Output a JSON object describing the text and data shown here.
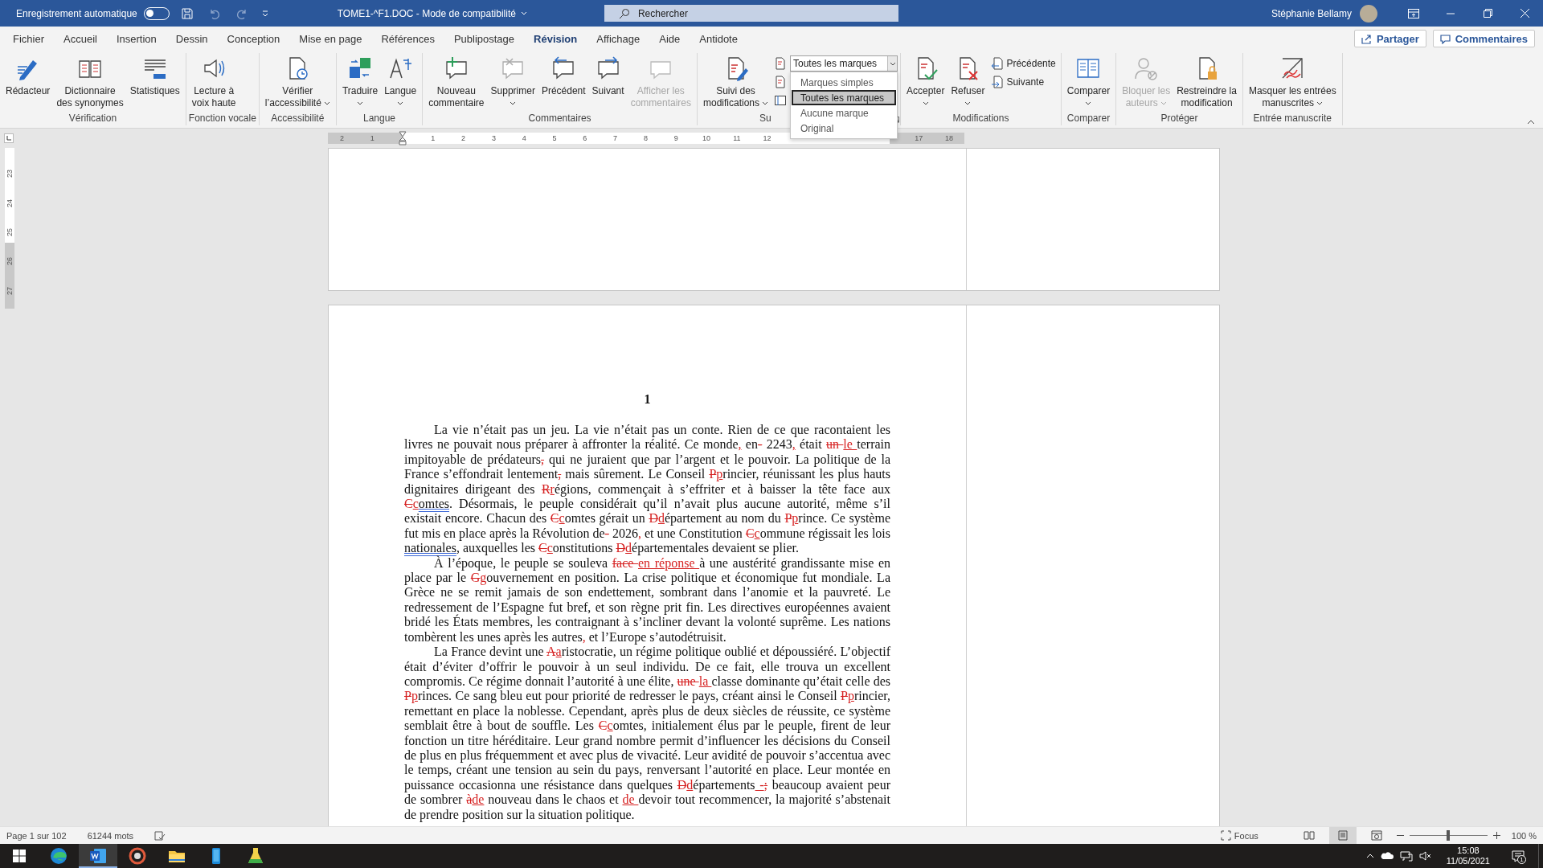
{
  "title_bar": {
    "autosave_label": "Enregistrement automatique",
    "autosave_on": false,
    "document_title": "TOME1-^F1.DOC  -  Mode de compatibilité",
    "search_placeholder": "Rechercher",
    "user_name": "Stéphanie Bellamy"
  },
  "menu_tabs": [
    {
      "label": "Fichier",
      "selected": false
    },
    {
      "label": "Accueil",
      "selected": false
    },
    {
      "label": "Insertion",
      "selected": false
    },
    {
      "label": "Dessin",
      "selected": false
    },
    {
      "label": "Conception",
      "selected": false
    },
    {
      "label": "Mise en page",
      "selected": false
    },
    {
      "label": "Références",
      "selected": false
    },
    {
      "label": "Publipostage",
      "selected": false
    },
    {
      "label": "Révision",
      "selected": true
    },
    {
      "label": "Affichage",
      "selected": false
    },
    {
      "label": "Aide",
      "selected": false
    },
    {
      "label": "Antidote",
      "selected": false
    }
  ],
  "share_button": "Partager",
  "comments_button": "Commentaires",
  "ribbon_groups": [
    {
      "label": "Vérification",
      "launcher": false,
      "commands": [
        {
          "label_lines": [
            "Rédacteur"
          ],
          "disabled": false,
          "dropdown": false
        },
        {
          "label_lines": [
            "Dictionnaire",
            "des synonymes"
          ],
          "disabled": false,
          "dropdown": false
        },
        {
          "label_lines": [
            "Statistiques"
          ],
          "disabled": false,
          "dropdown": false
        }
      ]
    },
    {
      "label": "Fonction vocale",
      "launcher": false,
      "commands": [
        {
          "label_lines": [
            "Lecture à",
            "voix haute"
          ],
          "disabled": false,
          "dropdown": false
        }
      ]
    },
    {
      "label": "Accessibilité",
      "launcher": false,
      "commands": [
        {
          "label_lines": [
            "Vérifier",
            "l’accessibilité"
          ],
          "disabled": false,
          "dropdown": true
        }
      ]
    },
    {
      "label": "Langue",
      "launcher": false,
      "commands": [
        {
          "label_lines": [
            "Traduire"
          ],
          "disabled": false,
          "dropdown": true
        },
        {
          "label_lines": [
            "Langue"
          ],
          "disabled": false,
          "dropdown": true
        }
      ]
    },
    {
      "label": "Commentaires",
      "launcher": false,
      "commands": [
        {
          "label_lines": [
            "Nouveau",
            "commentaire"
          ],
          "disabled": false,
          "dropdown": false
        },
        {
          "label_lines": [
            "Supprimer"
          ],
          "disabled": false,
          "dropdown": true
        },
        {
          "label_lines": [
            "Précédent"
          ],
          "disabled": false,
          "dropdown": false
        },
        {
          "label_lines": [
            "Suivant"
          ],
          "disabled": false,
          "dropdown": false
        },
        {
          "label_lines": [
            "Afficher les",
            "commentaires"
          ],
          "disabled": true,
          "dropdown": false
        }
      ]
    },
    {
      "label": "Su",
      "launcher": true,
      "commands": [
        {
          "label_lines": [
            "Suivi des",
            "modifications"
          ],
          "disabled": false,
          "dropdown": true
        }
      ],
      "small_items": [
        {
          "kind": "select",
          "value": "Toutes les marques",
          "options": [
            {
              "label": "Marques simples",
              "selected": false
            },
            {
              "label": "Toutes les marques",
              "selected": true
            },
            {
              "label": "Aucune marque",
              "selected": false
            },
            {
              "label": "Original",
              "selected": false
            }
          ]
        },
        {
          "kind": "icon"
        },
        {
          "kind": "icon"
        }
      ]
    },
    {
      "label": "Modifications",
      "launcher": false,
      "commands": [
        {
          "label_lines": [
            "Accepter"
          ],
          "disabled": false,
          "dropdown": true
        },
        {
          "label_lines": [
            "Refuser"
          ],
          "disabled": false,
          "dropdown": true
        }
      ],
      "small_items": [
        {
          "kind": "button",
          "label": "Précédente"
        },
        {
          "kind": "button",
          "label": "Suivante"
        }
      ]
    },
    {
      "label": "Comparer",
      "launcher": false,
      "commands": [
        {
          "label_lines": [
            "Comparer"
          ],
          "disabled": false,
          "dropdown": true
        }
      ]
    },
    {
      "label": "Protéger",
      "launcher": false,
      "commands": [
        {
          "label_lines": [
            "Bloquer les",
            "auteurs"
          ],
          "disabled": true,
          "dropdown": true
        },
        {
          "label_lines": [
            "Restreindre la",
            "modification"
          ],
          "disabled": false,
          "dropdown": false
        }
      ]
    },
    {
      "label": "Entrée manuscrite",
      "launcher": false,
      "commands": [
        {
          "label_lines": [
            "Masquer les entrées",
            "manuscrites"
          ],
          "disabled": false,
          "dropdown": true
        }
      ]
    }
  ],
  "ruler": {
    "before_indent": [
      "2",
      "1"
    ],
    "after_indent": [
      "1",
      "2",
      "3",
      "4",
      "5",
      "6",
      "7",
      "8",
      "9",
      "10",
      "11",
      "12"
    ],
    "end": [
      "17",
      "18"
    ]
  },
  "vertical_ruler": [
    "23",
    "24",
    "25",
    "26",
    "27"
  ],
  "document": {
    "heading": "1",
    "paragraphs": [
      {
        "runs": [
          {
            "kind": "text",
            "text": "La vie n’était pas un jeu. La vie n’était pas un conte. Rien de ce que racontaient les livres ne pouvait nous préparer à affronter la réalité. Ce monde"
          },
          {
            "kind": "inserted",
            "text": ","
          },
          {
            "kind": "text",
            "text": " en"
          },
          {
            "kind": "deleted",
            "text": "-"
          },
          {
            "kind": "text",
            "text": " 2243"
          },
          {
            "kind": "inserted",
            "text": ","
          },
          {
            "kind": "text",
            "text": " était "
          },
          {
            "kind": "deleted",
            "text": "un "
          },
          {
            "kind": "inserted",
            "text": "le "
          },
          {
            "kind": "text",
            "text": "terrain impitoyable de prédateurs"
          },
          {
            "kind": "deleted",
            "text": ","
          },
          {
            "kind": "text",
            "text": " qui ne juraient que par l’argent et le pouvoir. La politique de la France s’effondrait lentement"
          },
          {
            "kind": "deleted",
            "text": ","
          },
          {
            "kind": "text",
            "text": " mais sûrement. Le Conseil "
          },
          {
            "kind": "deleted",
            "text": "P"
          },
          {
            "kind": "inserted",
            "text": "p"
          },
          {
            "kind": "text",
            "text": "rincier, réunissant les plus hauts dignitaires dirigeant des "
          },
          {
            "kind": "deleted",
            "text": "R"
          },
          {
            "kind": "inserted",
            "text": "r"
          },
          {
            "kind": "text",
            "text": "égions, commençait à s’effriter et à baisser la tête face aux "
          },
          {
            "kind": "deleted",
            "text": "C"
          },
          {
            "kind": "inserted",
            "text": "c"
          },
          {
            "kind": "flagged",
            "text": "omtes"
          },
          {
            "kind": "text",
            "text": ". Désormais, le peuple considérait qu’il n’avait plus aucune autorité, même s’il existait encore. Chacun des "
          },
          {
            "kind": "deleted",
            "text": "C"
          },
          {
            "kind": "inserted",
            "text": "c"
          },
          {
            "kind": "text",
            "text": "omtes gérait un "
          },
          {
            "kind": "deleted",
            "text": "D"
          },
          {
            "kind": "inserted",
            "text": "d"
          },
          {
            "kind": "text",
            "text": "épartement au nom du "
          },
          {
            "kind": "deleted",
            "text": "P"
          },
          {
            "kind": "inserted",
            "text": "p"
          },
          {
            "kind": "text",
            "text": "rince. Ce système fut mis en place après la Révolution de"
          },
          {
            "kind": "deleted",
            "text": "-"
          },
          {
            "kind": "text",
            "text": " 2026"
          },
          {
            "kind": "inserted",
            "text": ","
          },
          {
            "kind": "text",
            "text": " et une Constitution "
          },
          {
            "kind": "deleted",
            "text": "C"
          },
          {
            "kind": "inserted",
            "text": "c"
          },
          {
            "kind": "text",
            "text": "ommune régissait les lois "
          },
          {
            "kind": "flagged",
            "text": "nationales"
          },
          {
            "kind": "text",
            "text": ", auxquelles les "
          },
          {
            "kind": "deleted",
            "text": "C"
          },
          {
            "kind": "inserted",
            "text": "c"
          },
          {
            "kind": "text",
            "text": "onstitutions "
          },
          {
            "kind": "deleted",
            "text": "D"
          },
          {
            "kind": "inserted",
            "text": "d"
          },
          {
            "kind": "text",
            "text": "épartementales devaient se plier."
          }
        ]
      },
      {
        "runs": [
          {
            "kind": "text",
            "text": "À l’époque, le peuple se souleva "
          },
          {
            "kind": "deleted",
            "text": "face "
          },
          {
            "kind": "inserted",
            "text": "en réponse "
          },
          {
            "kind": "text",
            "text": "à une austérité grandissante mise en place par le "
          },
          {
            "kind": "deleted",
            "text": "G"
          },
          {
            "kind": "inserted",
            "text": "g"
          },
          {
            "kind": "text",
            "text": "ouvernement en position. La crise politique et économique fut mondiale. La Grèce ne se remit jamais de son endettement, sombrant dans l’anomie et la pauvreté. Le redressement de l’Espagne fut bref, et son règne prit fin. Les directives européennes avaient bridé les États membres, les contraignant à s’incliner devant la volonté suprême. Les nations tombèrent les unes après les autres"
          },
          {
            "kind": "inserted",
            "text": ","
          },
          {
            "kind": "text",
            "text": " et l’Europe s’autodétruisit."
          }
        ]
      },
      {
        "runs": [
          {
            "kind": "text",
            "text": "La France devint une "
          },
          {
            "kind": "deleted",
            "text": "A"
          },
          {
            "kind": "inserted",
            "text": "a"
          },
          {
            "kind": "text",
            "text": "ristocratie, un régime politique oublié et dépoussiéré. L’objectif était d’éviter d’offrir le pouvoir à un seul individu. De ce fait, elle trouva un excellent compromis. Ce régime donnait l’autorité à une élite, "
          },
          {
            "kind": "deleted",
            "text": "une "
          },
          {
            "kind": "inserted",
            "text": "la "
          },
          {
            "kind": "text",
            "text": "classe dominante qu’était celle des "
          },
          {
            "kind": "deleted",
            "text": "P"
          },
          {
            "kind": "inserted",
            "text": "p"
          },
          {
            "kind": "text",
            "text": "rinces. Ce sang bleu eut pour priorité de redresser le pays, créant ainsi le Conseil "
          },
          {
            "kind": "deleted",
            "text": "P"
          },
          {
            "kind": "inserted",
            "text": "p"
          },
          {
            "kind": "text",
            "text": "rincier, remettant en place la noblesse. Cependant, après plus de deux siècles de réussite, ce système semblait être à bout de souffle. Les "
          },
          {
            "kind": "deleted",
            "text": "C"
          },
          {
            "kind": "inserted",
            "text": "c"
          },
          {
            "kind": "text",
            "text": "omtes, initialement élus par le peuple, firent de leur fonction un titre héréditaire. Leur grand nombre permit d’influencer les décisions du Conseil de plus en plus fréquemment et avec plus de vivacité. Leur avidité de pouvoir s’accentua avec le temps, créant une tension au sein du pays, renversant l’autorité en place. Leur montée en puissance occasionna une résistance dans quelques "
          },
          {
            "kind": "deleted",
            "text": "D"
          },
          {
            "kind": "inserted",
            "text": "d"
          },
          {
            "kind": "text",
            "text": "épartements"
          },
          {
            "kind": "inserted",
            "text": " -"
          },
          {
            "kind": "deleted",
            "text": ";"
          },
          {
            "kind": "text",
            "text": " beaucoup avaient peur de sombrer "
          },
          {
            "kind": "deleted",
            "text": "à"
          },
          {
            "kind": "inserted",
            "text": "de"
          },
          {
            "kind": "text",
            "text": " nouveau dans le chaos et "
          },
          {
            "kind": "inserted",
            "text": "de "
          },
          {
            "kind": "text",
            "text": "devoir tout recommencer, la majorité s’abstenait de prendre position sur la situation politique."
          }
        ]
      }
    ]
  },
  "status_bar": {
    "page": "Page 1 sur 102",
    "words": "61244 mots",
    "focus": "Focus",
    "views": [
      {
        "selected": false
      },
      {
        "selected": true
      },
      {
        "selected": false
      }
    ],
    "zoom_slider": {
      "level": 0.5
    },
    "zoom": "100 %"
  },
  "taskbar": {
    "apps": [
      {
        "selected": false
      },
      {
        "selected": true
      },
      {
        "selected": false
      },
      {
        "selected": false
      },
      {
        "selected": false
      },
      {
        "selected": false
      }
    ],
    "time": "15:08",
    "date": "11/05/2021",
    "notification_count": "1"
  }
}
